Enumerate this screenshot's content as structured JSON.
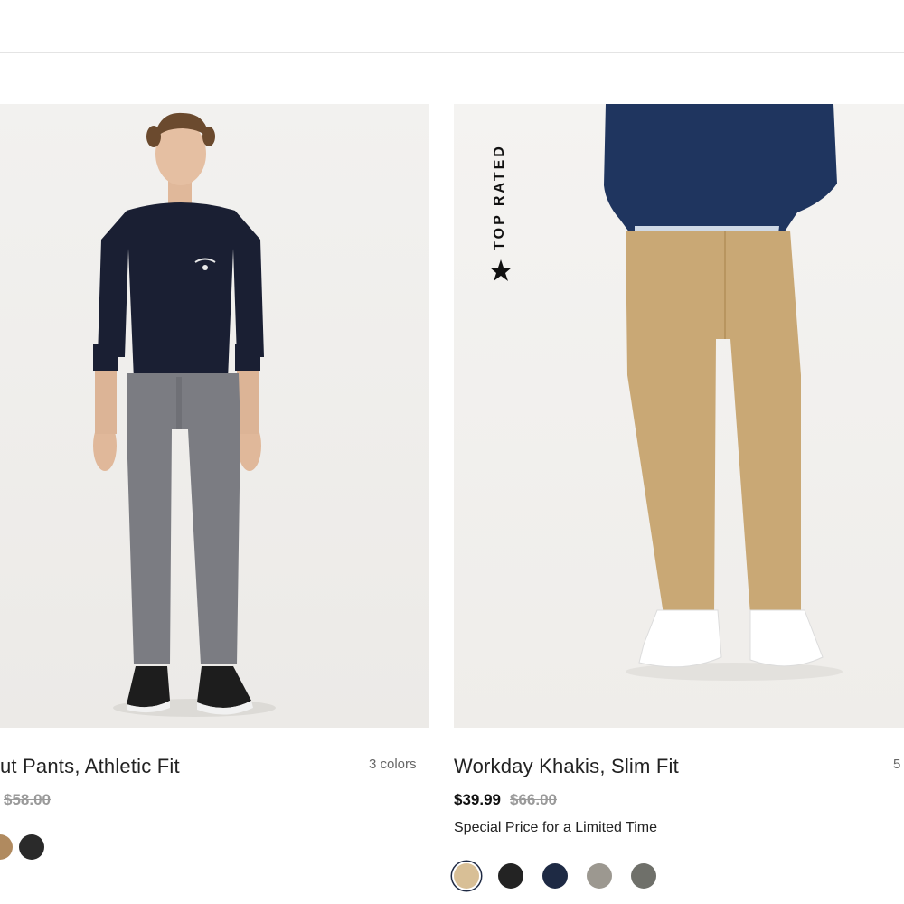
{
  "products": [
    {
      "name": "ut Pants, Athletic Fit",
      "colors_label": "3 colors",
      "price_original": "$58.00",
      "swatches": [
        {
          "name": "khaki",
          "color": "#b08a5f"
        },
        {
          "name": "black",
          "color": "#2a2a2a"
        }
      ]
    },
    {
      "name": "Workday Khakis, Slim Fit",
      "colors_label": "5",
      "badge": "TOP RATED",
      "price_sale": "$39.99",
      "price_original": "$66.00",
      "promo": "Special Price for a Limited Time",
      "swatches": [
        {
          "name": "khaki",
          "color": "#d8bf96",
          "selected": true
        },
        {
          "name": "black",
          "color": "#232323"
        },
        {
          "name": "navy",
          "color": "#1e2a44"
        },
        {
          "name": "stone",
          "color": "#9c9890"
        },
        {
          "name": "olive-grey",
          "color": "#6f706a"
        }
      ]
    }
  ]
}
